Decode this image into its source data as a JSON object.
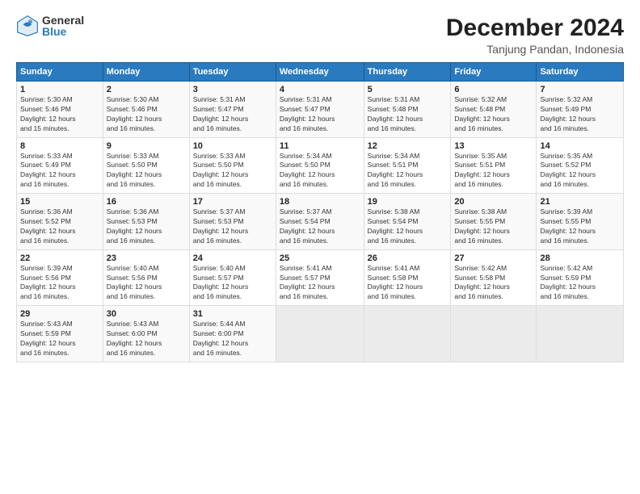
{
  "logo": {
    "general": "General",
    "blue": "Blue"
  },
  "title": "December 2024",
  "subtitle": "Tanjung Pandan, Indonesia",
  "days_of_week": [
    "Sunday",
    "Monday",
    "Tuesday",
    "Wednesday",
    "Thursday",
    "Friday",
    "Saturday"
  ],
  "weeks": [
    [
      {
        "day": "1",
        "info": "Sunrise: 5:30 AM\nSunset: 5:46 PM\nDaylight: 12 hours\nand 15 minutes."
      },
      {
        "day": "2",
        "info": "Sunrise: 5:30 AM\nSunset: 5:46 PM\nDaylight: 12 hours\nand 16 minutes."
      },
      {
        "day": "3",
        "info": "Sunrise: 5:31 AM\nSunset: 5:47 PM\nDaylight: 12 hours\nand 16 minutes."
      },
      {
        "day": "4",
        "info": "Sunrise: 5:31 AM\nSunset: 5:47 PM\nDaylight: 12 hours\nand 16 minutes."
      },
      {
        "day": "5",
        "info": "Sunrise: 5:31 AM\nSunset: 5:48 PM\nDaylight: 12 hours\nand 16 minutes."
      },
      {
        "day": "6",
        "info": "Sunrise: 5:32 AM\nSunset: 5:48 PM\nDaylight: 12 hours\nand 16 minutes."
      },
      {
        "day": "7",
        "info": "Sunrise: 5:32 AM\nSunset: 5:49 PM\nDaylight: 12 hours\nand 16 minutes."
      }
    ],
    [
      {
        "day": "8",
        "info": "Sunrise: 5:33 AM\nSunset: 5:49 PM\nDaylight: 12 hours\nand 16 minutes."
      },
      {
        "day": "9",
        "info": "Sunrise: 5:33 AM\nSunset: 5:50 PM\nDaylight: 12 hours\nand 16 minutes."
      },
      {
        "day": "10",
        "info": "Sunrise: 5:33 AM\nSunset: 5:50 PM\nDaylight: 12 hours\nand 16 minutes."
      },
      {
        "day": "11",
        "info": "Sunrise: 5:34 AM\nSunset: 5:50 PM\nDaylight: 12 hours\nand 16 minutes."
      },
      {
        "day": "12",
        "info": "Sunrise: 5:34 AM\nSunset: 5:51 PM\nDaylight: 12 hours\nand 16 minutes."
      },
      {
        "day": "13",
        "info": "Sunrise: 5:35 AM\nSunset: 5:51 PM\nDaylight: 12 hours\nand 16 minutes."
      },
      {
        "day": "14",
        "info": "Sunrise: 5:35 AM\nSunset: 5:52 PM\nDaylight: 12 hours\nand 16 minutes."
      }
    ],
    [
      {
        "day": "15",
        "info": "Sunrise: 5:36 AM\nSunset: 5:52 PM\nDaylight: 12 hours\nand 16 minutes."
      },
      {
        "day": "16",
        "info": "Sunrise: 5:36 AM\nSunset: 5:53 PM\nDaylight: 12 hours\nand 16 minutes."
      },
      {
        "day": "17",
        "info": "Sunrise: 5:37 AM\nSunset: 5:53 PM\nDaylight: 12 hours\nand 16 minutes."
      },
      {
        "day": "18",
        "info": "Sunrise: 5:37 AM\nSunset: 5:54 PM\nDaylight: 12 hours\nand 16 minutes."
      },
      {
        "day": "19",
        "info": "Sunrise: 5:38 AM\nSunset: 5:54 PM\nDaylight: 12 hours\nand 16 minutes."
      },
      {
        "day": "20",
        "info": "Sunrise: 5:38 AM\nSunset: 5:55 PM\nDaylight: 12 hours\nand 16 minutes."
      },
      {
        "day": "21",
        "info": "Sunrise: 5:39 AM\nSunset: 5:55 PM\nDaylight: 12 hours\nand 16 minutes."
      }
    ],
    [
      {
        "day": "22",
        "info": "Sunrise: 5:39 AM\nSunset: 5:56 PM\nDaylight: 12 hours\nand 16 minutes."
      },
      {
        "day": "23",
        "info": "Sunrise: 5:40 AM\nSunset: 5:56 PM\nDaylight: 12 hours\nand 16 minutes."
      },
      {
        "day": "24",
        "info": "Sunrise: 5:40 AM\nSunset: 5:57 PM\nDaylight: 12 hours\nand 16 minutes."
      },
      {
        "day": "25",
        "info": "Sunrise: 5:41 AM\nSunset: 5:57 PM\nDaylight: 12 hours\nand 16 minutes."
      },
      {
        "day": "26",
        "info": "Sunrise: 5:41 AM\nSunset: 5:58 PM\nDaylight: 12 hours\nand 16 minutes."
      },
      {
        "day": "27",
        "info": "Sunrise: 5:42 AM\nSunset: 5:58 PM\nDaylight: 12 hours\nand 16 minutes."
      },
      {
        "day": "28",
        "info": "Sunrise: 5:42 AM\nSunset: 5:59 PM\nDaylight: 12 hours\nand 16 minutes."
      }
    ],
    [
      {
        "day": "29",
        "info": "Sunrise: 5:43 AM\nSunset: 5:59 PM\nDaylight: 12 hours\nand 16 minutes."
      },
      {
        "day": "30",
        "info": "Sunrise: 5:43 AM\nSunset: 6:00 PM\nDaylight: 12 hours\nand 16 minutes."
      },
      {
        "day": "31",
        "info": "Sunrise: 5:44 AM\nSunset: 6:00 PM\nDaylight: 12 hours\nand 16 minutes."
      },
      {
        "day": "",
        "info": ""
      },
      {
        "day": "",
        "info": ""
      },
      {
        "day": "",
        "info": ""
      },
      {
        "day": "",
        "info": ""
      }
    ]
  ]
}
